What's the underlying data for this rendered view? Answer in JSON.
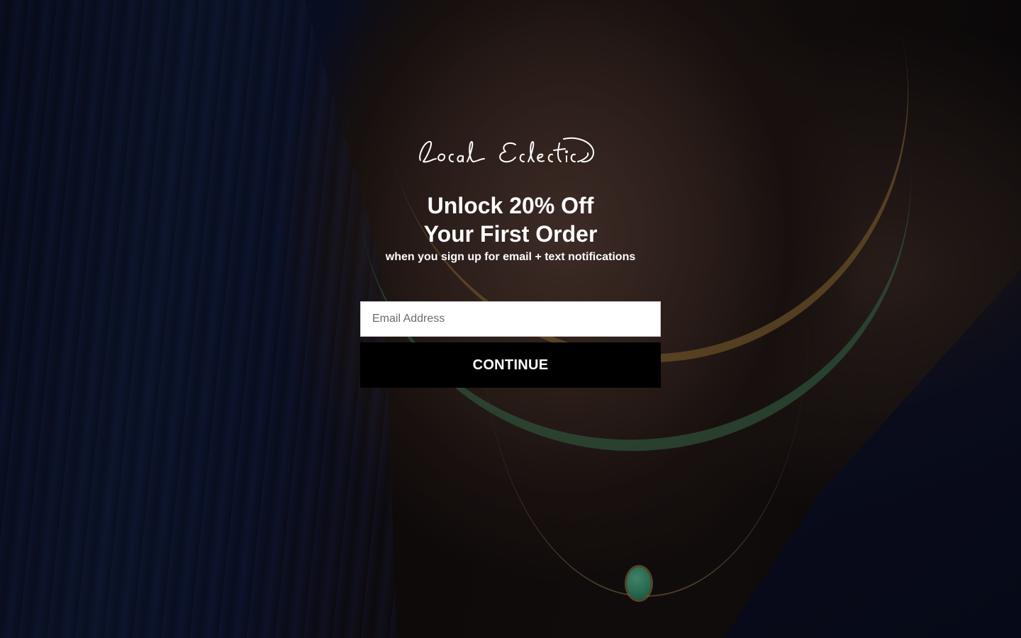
{
  "brand": {
    "logo_text": "Local Eclectic"
  },
  "popup": {
    "headline_line1": "Unlock 20% Off",
    "headline_line2": "Your First Order",
    "subline": "when you sign up for email + text notifications",
    "email_placeholder": "Email Address",
    "email_value": "",
    "continue_label": "CONTINUE"
  },
  "colors": {
    "text": "#ffffff",
    "button_bg": "#000000",
    "input_bg": "#ffffff"
  }
}
